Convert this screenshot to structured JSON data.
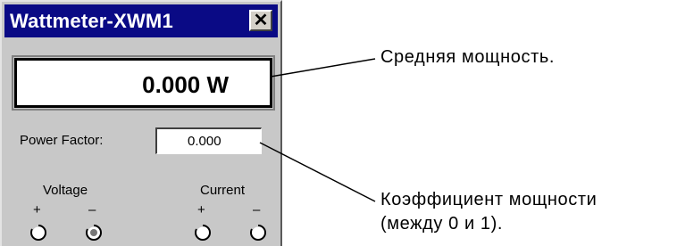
{
  "window": {
    "title": "Wattmeter-XWM1",
    "close_glyph": "✕"
  },
  "display": {
    "value": "0.000 W"
  },
  "power_factor": {
    "label": "Power Factor:",
    "value": "0.000"
  },
  "terminals": {
    "voltage_label": "Voltage",
    "current_label": "Current",
    "plus": "+",
    "minus": "–"
  },
  "callouts": {
    "average_power": "Средняя мощность.",
    "pf_line1": "Коэффициент мощности",
    "pf_line2": "(между 0 и 1)."
  }
}
